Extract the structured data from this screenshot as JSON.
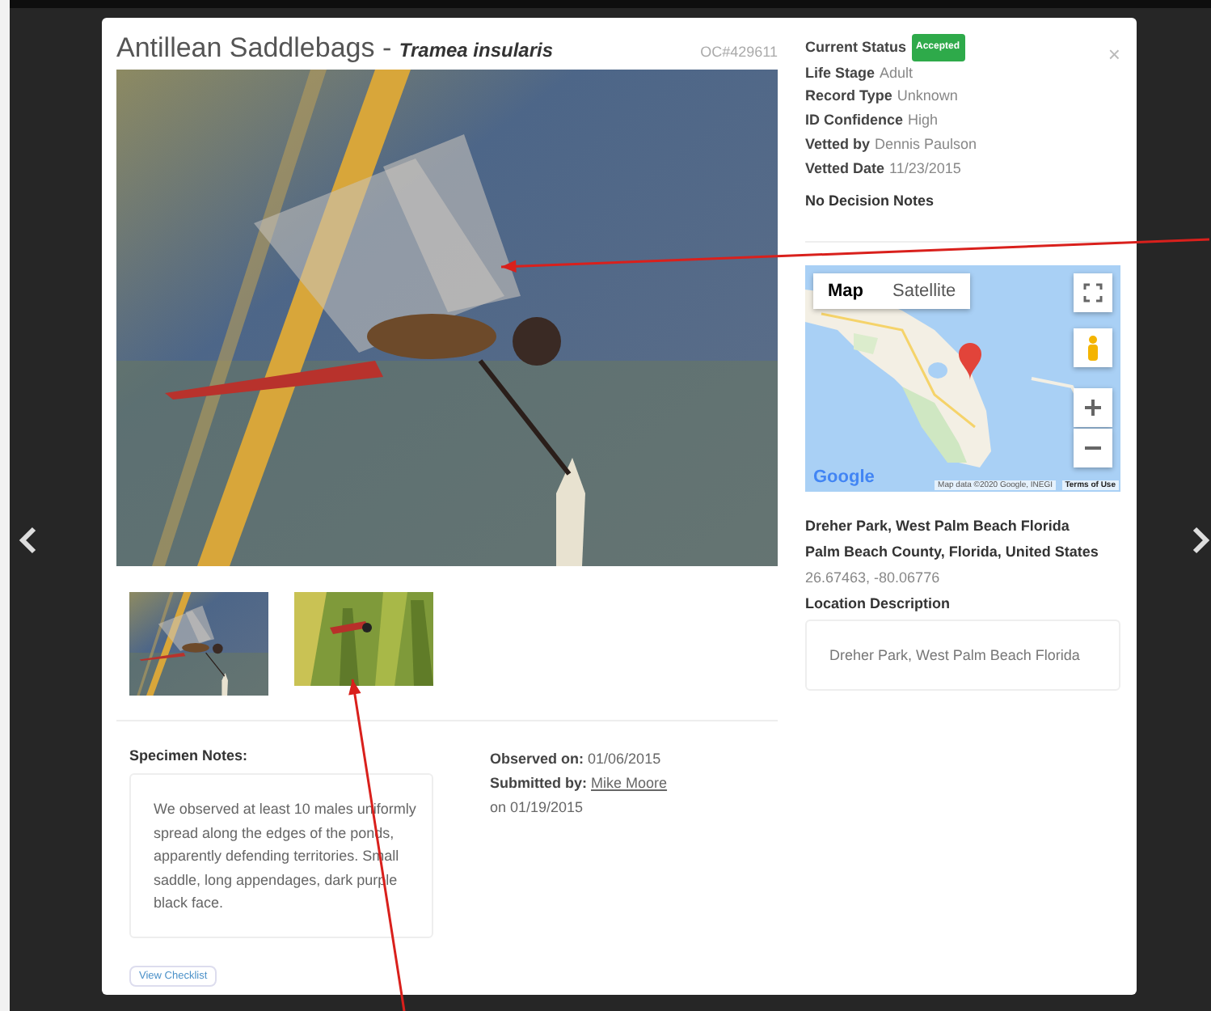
{
  "modal": {
    "title": "Antillean Saddlebags",
    "separator": "-",
    "scientific_name": "Tramea insularis",
    "record_id": "OC#429611",
    "close": "×"
  },
  "status": [
    {
      "label": "Current Status",
      "value": "Accepted",
      "kind": "badge"
    },
    {
      "label": "Life Stage",
      "value": "Adult",
      "kind": "text"
    },
    {
      "label": "Record Type",
      "value": "Unknown",
      "kind": "text"
    },
    {
      "label": "ID Confidence",
      "value": "High",
      "kind": "text"
    },
    {
      "label": "Vetted by",
      "value": "Dennis Paulson",
      "kind": "text"
    },
    {
      "label": "Vetted Date",
      "value": "11/23/2015",
      "kind": "text"
    }
  ],
  "decision_notes": "No Decision Notes",
  "map": {
    "tabs": [
      {
        "label": "Map",
        "selected": true
      },
      {
        "label": "Satellite",
        "selected": false
      }
    ],
    "logo": "Google",
    "attribution": "Map data ©2020 Google, INEGI",
    "terms": "Terms of Use"
  },
  "location": {
    "name": "Dreher Park, West Palm Beach Florida",
    "region": "Palm Beach County, Florida, United States",
    "coordinates": "26.67463, -80.06776",
    "description_label": "Location Description",
    "description": "Dreher Park, West Palm Beach Florida"
  },
  "specimen_notes": {
    "label": "Specimen Notes:",
    "text": "We observed at least 10 males uniformly spread along the edges of the ponds, apparently defending territories. Small saddle, long appendages, dark purple black face."
  },
  "observation": {
    "observed_label": "Observed on:",
    "observed": "01/06/2015",
    "submitted_label": "Submitted by:",
    "submitter": "Mike Moore",
    "submitted_date": "on 01/19/2015"
  },
  "checklist_button": "View Checklist"
}
